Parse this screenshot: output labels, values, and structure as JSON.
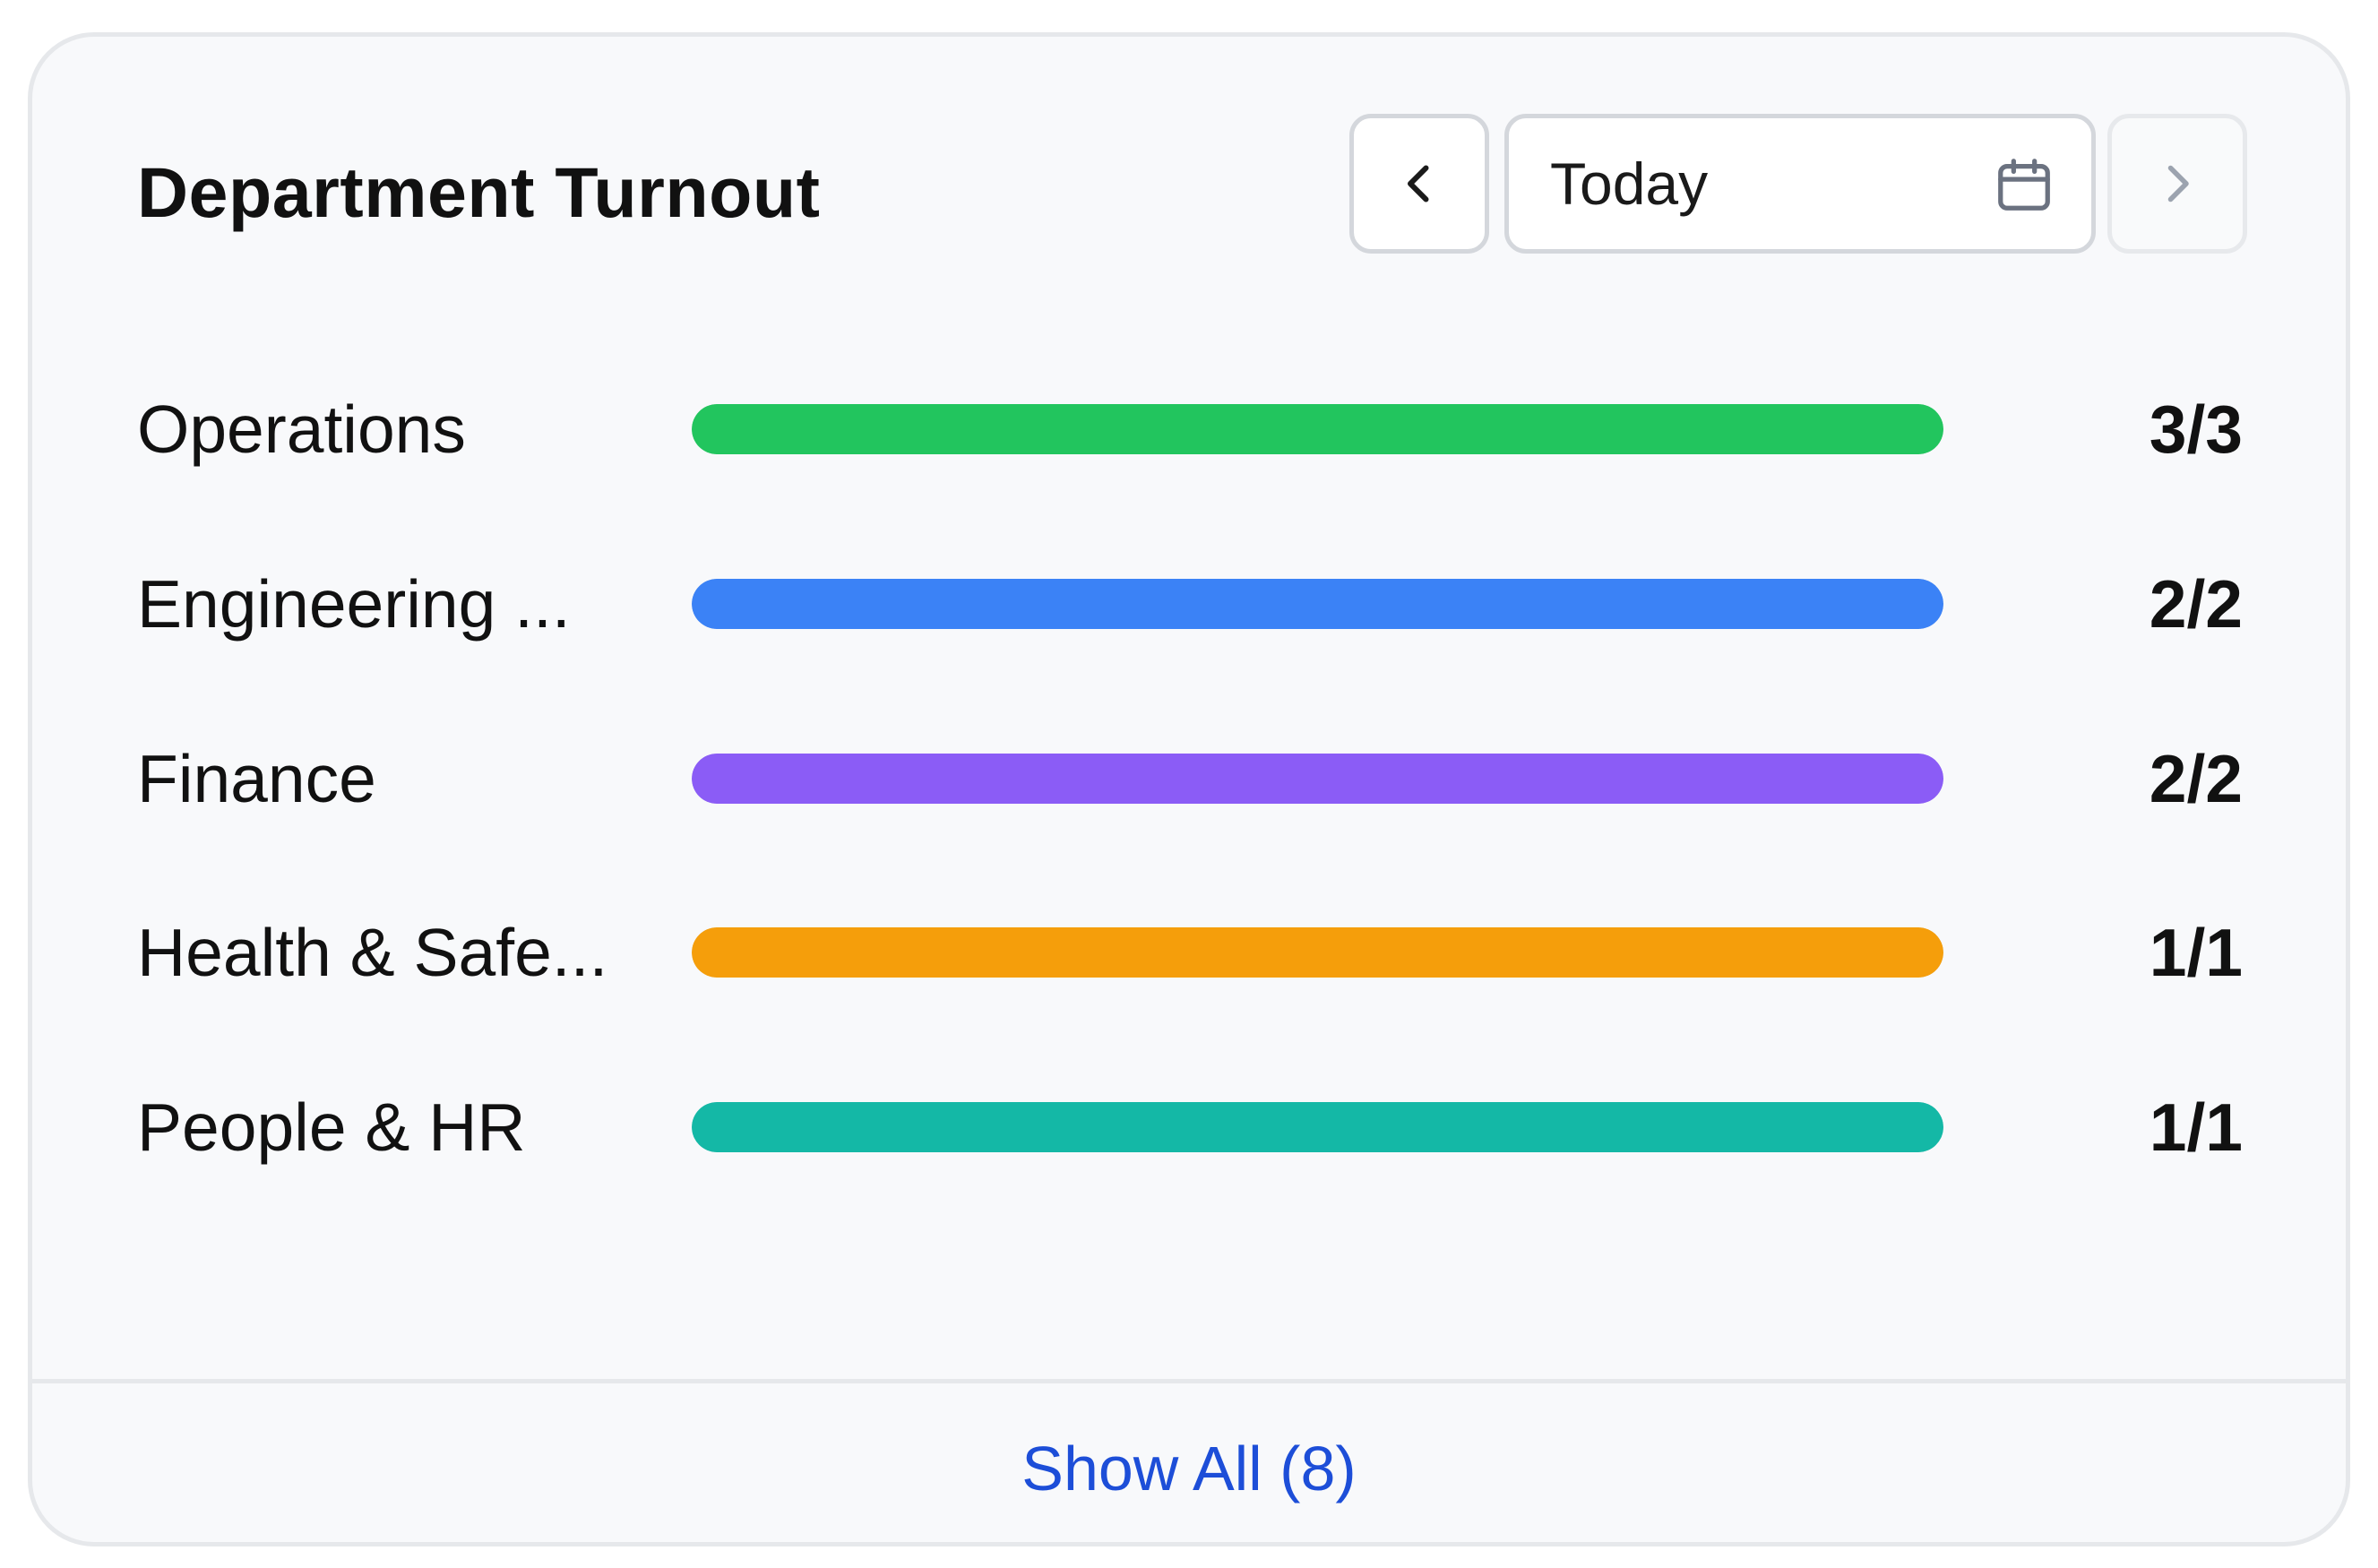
{
  "header": {
    "title": "Department Turnout"
  },
  "date_nav": {
    "prev_icon": "chevron-left-icon",
    "date_label": "Today",
    "calendar_icon": "calendar-icon",
    "next_icon": "chevron-right-icon"
  },
  "departments": [
    {
      "label": "Operations",
      "count": "3/3",
      "present": 3,
      "total": 3,
      "fraction": 1.0,
      "color": "#22c55e"
    },
    {
      "label": "Engineering ...",
      "count": "2/2",
      "present": 2,
      "total": 2,
      "fraction": 1.0,
      "color": "#3b82f6"
    },
    {
      "label": "Finance",
      "count": "2/2",
      "present": 2,
      "total": 2,
      "fraction": 1.0,
      "color": "#8b5cf6"
    },
    {
      "label": "Health & Safe...",
      "count": "1/1",
      "present": 1,
      "total": 1,
      "fraction": 1.0,
      "color": "#f59e0b"
    },
    {
      "label": "People & HR",
      "count": "1/1",
      "present": 1,
      "total": 1,
      "fraction": 1.0,
      "color": "#14b8a6"
    }
  ],
  "footer": {
    "show_all_label": "Show All (8)",
    "link_color": "#1d4ed8"
  }
}
